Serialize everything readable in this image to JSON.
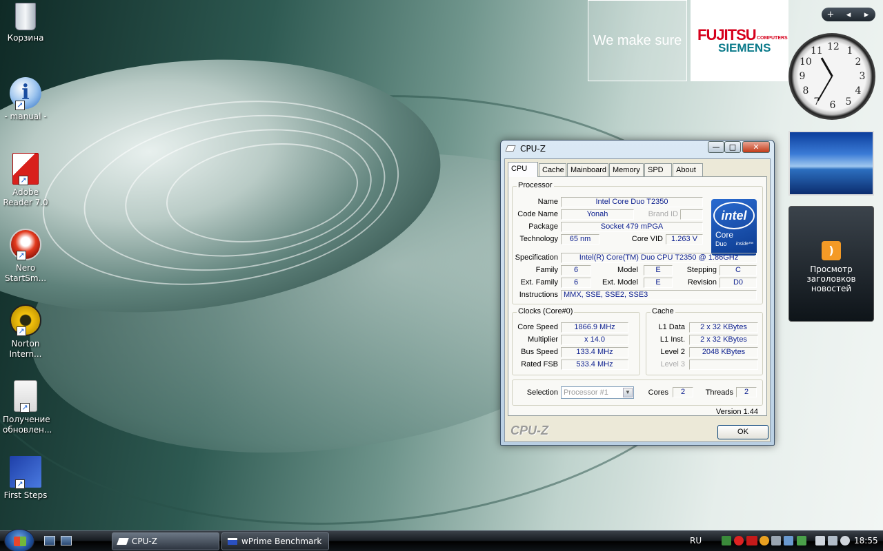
{
  "desktop": {
    "icons": [
      {
        "label": "Корзина",
        "icon": "recycle-bin-icon"
      },
      {
        "label": "- manual -",
        "icon": "info-icon"
      },
      {
        "label": "Adobe Reader 7.0",
        "icon": "adobe-reader-icon"
      },
      {
        "label": "Nero StartSm...",
        "icon": "nero-icon"
      },
      {
        "label": "Norton Intern...",
        "icon": "norton-icon"
      },
      {
        "label": "Получение обновлен...",
        "icon": "update-icon"
      },
      {
        "label": "First Steps",
        "icon": "first-steps-icon"
      }
    ],
    "wallpaper_banner": {
      "slogan": "We make sure",
      "brand_top": "FUJITSU",
      "brand_small": "COMPUTERS",
      "brand_bottom": "SIEMENS"
    }
  },
  "sidebar": {
    "controls": [
      "+",
      "◂",
      "▸"
    ],
    "clock": {
      "numbers": [
        "12",
        "1",
        "2",
        "3",
        "4",
        "5",
        "6",
        "7",
        "8",
        "9",
        "10",
        "11"
      ],
      "time": "18:55"
    },
    "rss_gadget": {
      "text": "Просмотр заголовков новостей"
    }
  },
  "window": {
    "title": "CPU-Z",
    "controls": {
      "minimize": "—",
      "maximize": "□",
      "close": "✕"
    },
    "tabs": [
      "CPU",
      "Cache",
      "Mainboard",
      "Memory",
      "SPD",
      "About"
    ],
    "active_tab": "CPU",
    "processor": {
      "group_title": "Processor",
      "name_label": "Name",
      "name": "Intel Core Duo T2350",
      "codename_label": "Code Name",
      "codename": "Yonah",
      "brandid_label": "Brand ID",
      "brandid": "",
      "package_label": "Package",
      "package": "Socket 479 mPGA",
      "technology_label": "Technology",
      "technology": "65 nm",
      "corevid_label": "Core VID",
      "corevid": "1.263 V",
      "spec_label": "Specification",
      "spec": "Intel(R) Core(TM) Duo CPU      T2350  @ 1.86GHz",
      "family_label": "Family",
      "family": "6",
      "model_label": "Model",
      "model": "E",
      "stepping_label": "Stepping",
      "stepping": "C",
      "extfamily_label": "Ext. Family",
      "extfamily": "6",
      "extmodel_label": "Ext. Model",
      "extmodel": "E",
      "revision_label": "Revision",
      "revision": "D0",
      "instructions_label": "Instructions",
      "instructions": "MMX, SSE, SSE2, SSE3"
    },
    "logo": {
      "intel": "intel",
      "core": "Core",
      "duo": "Duo",
      "inside": "inside™"
    },
    "clocks": {
      "group_title": "Clocks (Core#0)",
      "corespeed_label": "Core Speed",
      "corespeed": "1866.9 MHz",
      "multiplier_label": "Multiplier",
      "multiplier": "x 14.0",
      "busspeed_label": "Bus Speed",
      "busspeed": "133.4 MHz",
      "ratedfsb_label": "Rated FSB",
      "ratedfsb": "533.4 MHz"
    },
    "cache": {
      "group_title": "Cache",
      "l1data_label": "L1 Data",
      "l1data": "2 x 32 KBytes",
      "l1inst_label": "L1 Inst.",
      "l1inst": "2 x 32 KBytes",
      "level2_label": "Level 2",
      "level2": "2048 KBytes",
      "level3_label": "Level 3",
      "level3": ""
    },
    "selection": {
      "label": "Selection",
      "value": "Processor #1",
      "cores_label": "Cores",
      "cores": "2",
      "threads_label": "Threads",
      "threads": "2"
    },
    "version": "Version 1.44",
    "brand": "CPU-Z",
    "ok_label": "OK"
  },
  "taskbar": {
    "buttons": [
      {
        "label": "CPU-Z",
        "active": true
      },
      {
        "label": "wPrime Benchmark ...",
        "active": false
      }
    ],
    "language": "RU",
    "time": "18:55"
  }
}
